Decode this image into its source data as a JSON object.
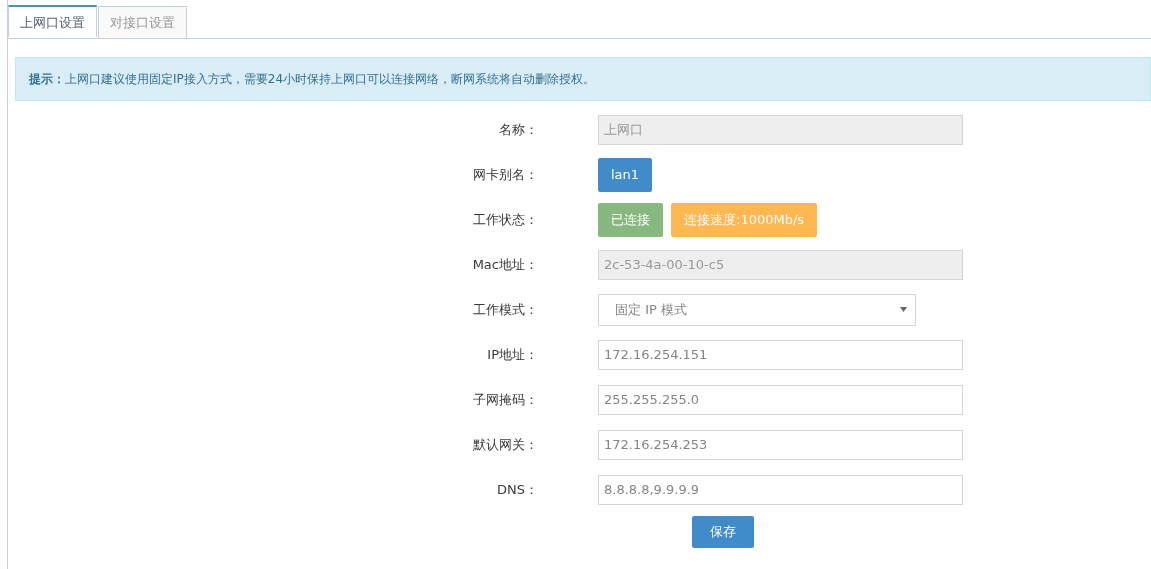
{
  "tabs": [
    {
      "label": "上网口设置",
      "selected": true
    },
    {
      "label": "对接口设置",
      "selected": false
    }
  ],
  "alert": {
    "text": "**提示：**上网口建议使用固定IP接入方式，需要24小时保持上网口可以连接网络，断网系统将自动删除授权。"
  },
  "form": {
    "rows": [
      {
        "label": "名称：",
        "kind": "input",
        "value": "上网口",
        "disabled": true
      },
      {
        "label": "网卡别名：",
        "kind": "badges",
        "badges": [
          {
            "text": "lan1",
            "color": "#428bca"
          }
        ]
      },
      {
        "label": "工作状态：",
        "kind": "badges",
        "badges": [
          {
            "text": "已连接",
            "color": "#87b87f"
          },
          {
            "text": "连接速度:1000Mb/s",
            "color": "#ffb752"
          }
        ]
      },
      {
        "label": "Mac地址：",
        "kind": "input",
        "value": "2c-53-4a-00-10-c5",
        "disabled": true
      },
      {
        "label": "工作模式：",
        "kind": "select",
        "value": "固定 IP 模式"
      },
      {
        "label": "IP地址：",
        "kind": "input",
        "value": "172.16.254.151",
        "disabled": false
      },
      {
        "label": "子网掩码：",
        "kind": "input",
        "value": "255.255.255.0",
        "disabled": false
      },
      {
        "label": "默认网关：",
        "kind": "input",
        "value": "172.16.254.253",
        "disabled": false
      },
      {
        "label": "DNS：",
        "kind": "input",
        "value": "8.8.8.8,9.9.9.9",
        "disabled": false
      }
    ],
    "submit": "保存"
  }
}
